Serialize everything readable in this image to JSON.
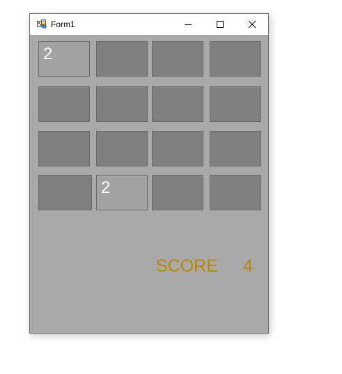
{
  "window": {
    "title": "Form1",
    "icon": "winforms-app-icon",
    "caption_buttons": [
      "minimize-icon",
      "maximize-icon",
      "close-icon"
    ]
  },
  "board": {
    "rows": 4,
    "cols": 4,
    "tiles": [
      [
        "2",
        "",
        "",
        ""
      ],
      [
        "",
        "",
        "",
        ""
      ],
      [
        "",
        "",
        "",
        ""
      ],
      [
        "",
        "2",
        "",
        ""
      ]
    ]
  },
  "score": {
    "label": "SCORE",
    "value": "4"
  },
  "colors": {
    "form_background": "#a9a9a9",
    "empty_tile": "#808080",
    "filled_tile": "#a3a3a3",
    "tile_text": "#ffffff",
    "score_text": "#b8860b"
  }
}
